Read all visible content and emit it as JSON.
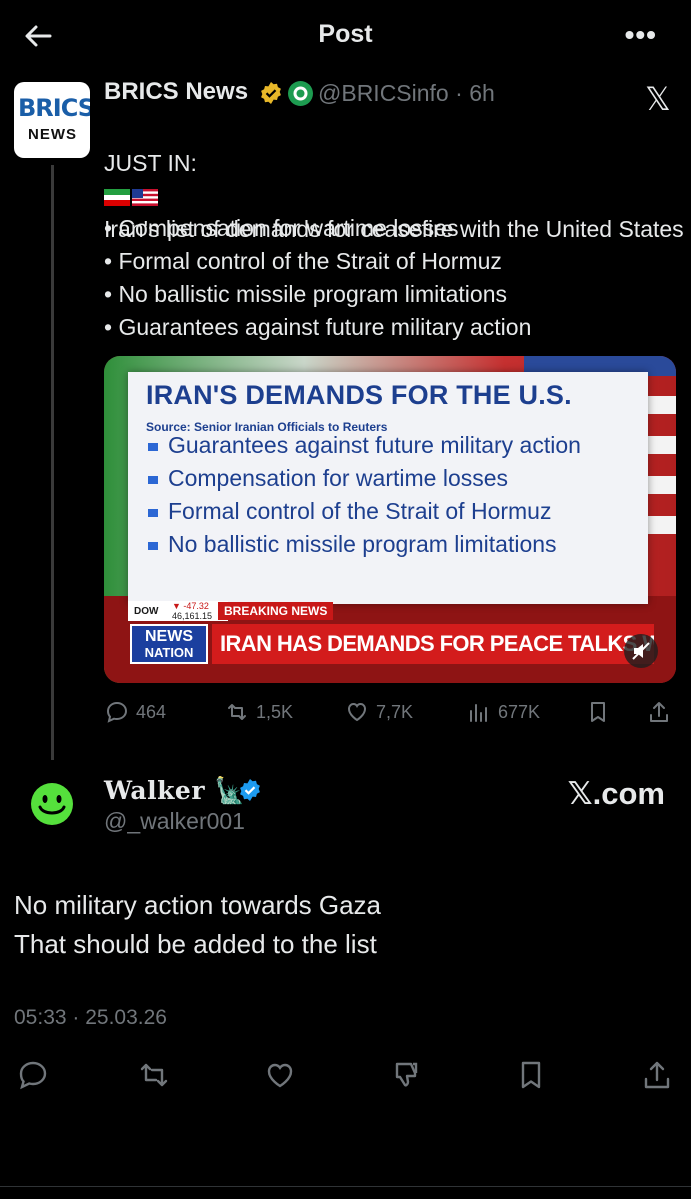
{
  "header": {
    "title": "Post",
    "more_label": "•••"
  },
  "quoted_tweet": {
    "avatar_text_top": "BRICS",
    "avatar_text_bottom": "NEWS",
    "author_name": "BRICS News",
    "handle": "@BRICSinfo",
    "separator": "·",
    "time": "6h",
    "x_logo": "𝕏",
    "text_prefix": "JUST IN:",
    "text_headline": "Iran's list of demands for ceasefire with the United States",
    "bullets": [
      "• Compensation for wartime losses",
      "• Formal control of the Strait of Hormuz",
      "• No ballistic missile program limitations",
      "• Guarantees against future military action"
    ],
    "media": {
      "title": "IRAN'S DEMANDS FOR THE U.S.",
      "source": "Source: Senior Iranian Officials to Reuters",
      "items": [
        "Guarantees against future military action",
        "Compensation for wartime losses",
        "Formal control of the Strait of Hormuz",
        "No ballistic missile program limitations"
      ],
      "ticker_label": "DOW",
      "ticker_change": "▼ -47.32",
      "ticker_value": "46,161.15",
      "breaking": "BREAKING NEWS",
      "network_line1": "NEWS",
      "network_line2": "NATION",
      "banner": "IRAN HAS DEMANDS FOR PEACE TALKS WITH U.S."
    },
    "stats": {
      "replies": "464",
      "reposts": "1,5K",
      "likes": "7,7K",
      "views": "677K"
    }
  },
  "reply": {
    "author_name": "Walker",
    "name_emoji": "🗽",
    "handle": "@_walker001",
    "watermark": "𝕏.com",
    "text": "No military action towards Gaza\nThat should be added to the list",
    "timestamp": "05:33 · 25.03.26"
  },
  "colors": {
    "background": "#000000",
    "text": "#e7e9ea",
    "muted": "#71767b",
    "verified_blue": "#1d9bf0",
    "verified_gold": "#e8b829",
    "avatar_green": "#55e03c"
  },
  "icons": [
    "back-arrow-icon",
    "more-icon",
    "verified-gold-icon",
    "affiliate-icon",
    "x-logo-icon",
    "reply-icon",
    "repost-icon",
    "like-icon",
    "views-icon",
    "bookmark-icon",
    "share-icon",
    "verified-blue-icon",
    "smiley-avatar",
    "dislike-icon",
    "mute-icon"
  ]
}
